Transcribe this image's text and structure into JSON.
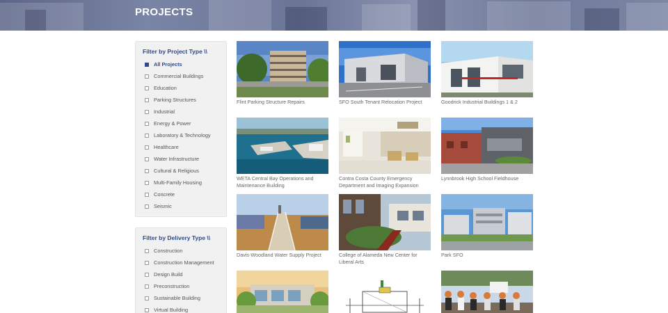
{
  "page": {
    "title": "PROJECTS"
  },
  "filters": {
    "project_type": {
      "title": "Filter by Project Type \\\\",
      "items": [
        "All Projects",
        "Commercial Buildings",
        "Education",
        "Parking Structures",
        "Industrial",
        "Energy & Power",
        "Laboratory & Technology",
        "Healthcare",
        "Water Infrastructure",
        "Cultural & Religious",
        "Multi-Family Housing",
        "Concrete",
        "Seismic"
      ]
    },
    "delivery_type": {
      "title": "Filter by Delivery Type \\\\",
      "items": [
        "Construction",
        "Construction Management",
        "Design Build",
        "Preconstruction",
        "Sustainable Building",
        "Virtual Building"
      ]
    }
  },
  "projects": [
    {
      "title": "Flint Parking Structure Repairs"
    },
    {
      "title": "SFO South Tenant Relocation Project"
    },
    {
      "title": "Goodrick Industrial Buildings 1 & 2"
    },
    {
      "title": "WETA Central Bay Operations and Maintenance Building"
    },
    {
      "title": "Contra Costa County Emergency Department and Imaging Expansion"
    },
    {
      "title": "Lynnbrook High School Fieldhouse"
    },
    {
      "title": "Davis-Woodland Water Supply Project"
    },
    {
      "title": "College of Alameda New Center for Liberal Arts"
    },
    {
      "title": "Park SFO"
    },
    {
      "title": ""
    },
    {
      "title": ""
    },
    {
      "title": ""
    }
  ],
  "colors": {
    "accent": "#2f4b87",
    "banner": "#6b7597",
    "panel_bg": "#f1f1f1"
  }
}
